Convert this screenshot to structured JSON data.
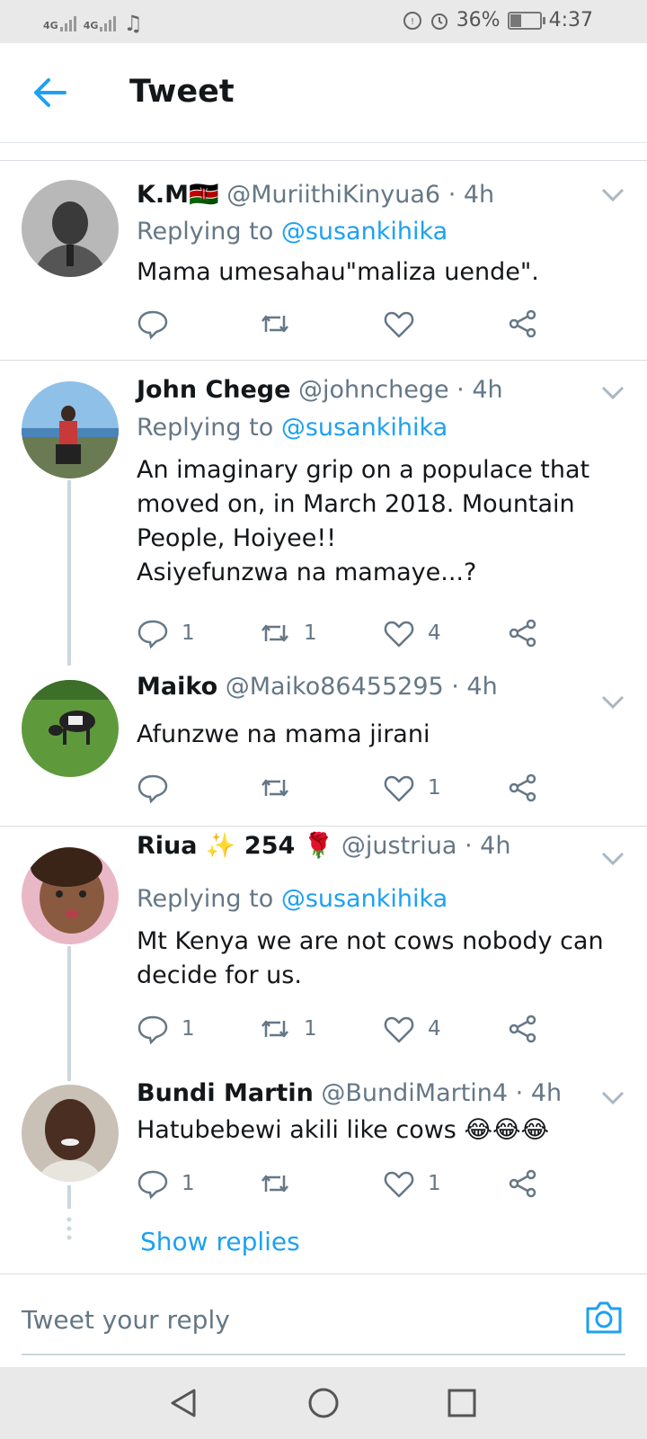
{
  "status": {
    "net1": "4G",
    "net2": "4G",
    "battery": "36%",
    "battery_level": 0.36,
    "time": "4:37"
  },
  "header": {
    "title": "Tweet"
  },
  "tweets": [
    {
      "name": "K.M🇰🇪",
      "handle": "@MuriithiKinyua6 · 4h",
      "replying_prefix": "Replying to ",
      "replying_handle": "@susankihika",
      "text": "Mama umesahau\"maliza uende\".",
      "replies": "",
      "retweets": "",
      "likes": ""
    },
    {
      "name": "John Chege",
      "handle": "@johnchege · 4h",
      "replying_prefix": "Replying to ",
      "replying_handle": "@susankihika",
      "text_lines": [
        "An imaginary grip on a populace that",
        "moved on, in March 2018. Mountain",
        "People, Hoiyee!!",
        "Asiyefunzwa na mamaye...?"
      ],
      "replies": "1",
      "retweets": "1",
      "likes": "4"
    },
    {
      "name": "Maiko",
      "handle": "@Maiko86455295 · 4h",
      "text": "Afunzwe na mama jirani",
      "replies": "",
      "retweets": "",
      "likes": "1"
    },
    {
      "name": "Riua ✨ 254 🌹",
      "handle": "@justriua · 4h",
      "replying_prefix": "Replying to ",
      "replying_handle": "@susankihika",
      "text_lines": [
        "Mt Kenya we are not cows nobody can",
        "decide for us."
      ],
      "replies": "1",
      "retweets": "1",
      "likes": "4"
    },
    {
      "name": "Bundi Martin",
      "handle": "@BundiMartin4 · 4h",
      "text": "Hatubebewi akili like cows 😂😂😂",
      "replies": "1",
      "retweets": "",
      "likes": "1"
    }
  ],
  "show_replies": "Show replies",
  "composer": {
    "placeholder": "Tweet your reply"
  },
  "colors": {
    "accent": "#1da1f2",
    "text": "#14171a",
    "secondary": "#657786",
    "divider": "#d9dee2"
  }
}
